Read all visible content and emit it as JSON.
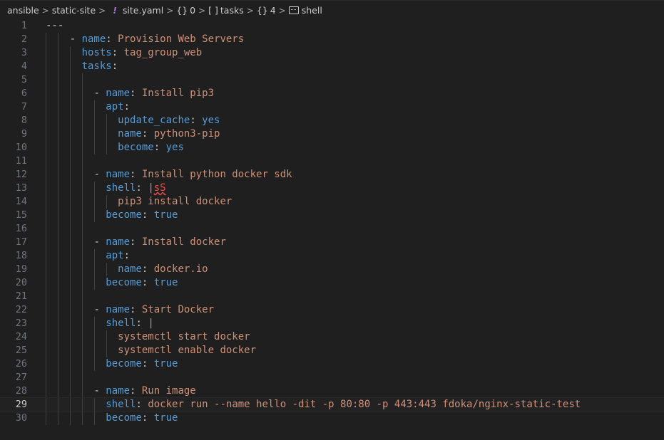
{
  "breadcrumb": {
    "items": [
      "ansible",
      "static-site",
      "site.yaml",
      "0",
      "tasks",
      "4",
      "shell"
    ],
    "symbols": [
      "{}",
      "[ ]",
      "{}"
    ],
    "icons": [
      "chevron-right-icon",
      "yaml-file-icon",
      "object-icon",
      "array-icon",
      "string-icon"
    ]
  },
  "editor": {
    "current_line": 29,
    "lines": [
      {
        "n": "1",
        "indent": 0,
        "tokens": [
          [
            "p",
            "---"
          ]
        ]
      },
      {
        "n": "2",
        "indent": 2,
        "tokens": [
          [
            "d",
            "- "
          ],
          [
            "k",
            "name"
          ],
          [
            "p",
            ": "
          ],
          [
            "s",
            "Provision Web Servers"
          ]
        ]
      },
      {
        "n": "3",
        "indent": 3,
        "tokens": [
          [
            "k",
            "hosts"
          ],
          [
            "p",
            ": "
          ],
          [
            "s",
            "tag_group_web"
          ]
        ]
      },
      {
        "n": "4",
        "indent": 3,
        "tokens": [
          [
            "k",
            "tasks"
          ],
          [
            "p",
            ":"
          ]
        ]
      },
      {
        "n": "5",
        "indent": 0,
        "tokens": []
      },
      {
        "n": "6",
        "indent": 4,
        "tokens": [
          [
            "d",
            "- "
          ],
          [
            "k",
            "name"
          ],
          [
            "p",
            ": "
          ],
          [
            "s",
            "Install pip3"
          ]
        ]
      },
      {
        "n": "7",
        "indent": 5,
        "tokens": [
          [
            "k",
            "apt"
          ],
          [
            "p",
            ":"
          ]
        ]
      },
      {
        "n": "8",
        "indent": 6,
        "tokens": [
          [
            "k",
            "update_cache"
          ],
          [
            "p",
            ": "
          ],
          [
            "k",
            "yes"
          ]
        ]
      },
      {
        "n": "9",
        "indent": 6,
        "tokens": [
          [
            "k",
            "name"
          ],
          [
            "p",
            ": "
          ],
          [
            "s",
            "python3-pip"
          ]
        ]
      },
      {
        "n": "10",
        "indent": 6,
        "tokens": [
          [
            "k",
            "become"
          ],
          [
            "p",
            ": "
          ],
          [
            "k",
            "yes"
          ]
        ]
      },
      {
        "n": "11",
        "indent": 0,
        "tokens": []
      },
      {
        "n": "12",
        "indent": 4,
        "tokens": [
          [
            "d",
            "- "
          ],
          [
            "k",
            "name"
          ],
          [
            "p",
            ": "
          ],
          [
            "s",
            "Install python docker sdk"
          ]
        ]
      },
      {
        "n": "13",
        "indent": 5,
        "tokens": [
          [
            "k",
            "shell"
          ],
          [
            "p",
            ": "
          ],
          [
            "pipe",
            "|"
          ],
          [
            "err",
            "sS"
          ]
        ]
      },
      {
        "n": "14",
        "indent": 6,
        "tokens": [
          [
            "s",
            "pip3 install docker"
          ]
        ]
      },
      {
        "n": "15",
        "indent": 5,
        "tokens": [
          [
            "k",
            "become"
          ],
          [
            "p",
            ": "
          ],
          [
            "k",
            "true"
          ]
        ]
      },
      {
        "n": "16",
        "indent": 0,
        "tokens": []
      },
      {
        "n": "17",
        "indent": 4,
        "tokens": [
          [
            "d",
            "- "
          ],
          [
            "k",
            "name"
          ],
          [
            "p",
            ": "
          ],
          [
            "s",
            "Install docker"
          ]
        ]
      },
      {
        "n": "18",
        "indent": 5,
        "tokens": [
          [
            "k",
            "apt"
          ],
          [
            "p",
            ":"
          ]
        ]
      },
      {
        "n": "19",
        "indent": 6,
        "tokens": [
          [
            "k",
            "name"
          ],
          [
            "p",
            ": "
          ],
          [
            "s",
            "docker.io"
          ]
        ]
      },
      {
        "n": "20",
        "indent": 5,
        "tokens": [
          [
            "k",
            "become"
          ],
          [
            "p",
            ": "
          ],
          [
            "k",
            "true"
          ]
        ]
      },
      {
        "n": "21",
        "indent": 0,
        "tokens": []
      },
      {
        "n": "22",
        "indent": 4,
        "tokens": [
          [
            "d",
            "- "
          ],
          [
            "k",
            "name"
          ],
          [
            "p",
            ": "
          ],
          [
            "s",
            "Start Docker"
          ]
        ]
      },
      {
        "n": "23",
        "indent": 5,
        "tokens": [
          [
            "k",
            "shell"
          ],
          [
            "p",
            ": "
          ],
          [
            "pipe",
            "|"
          ]
        ]
      },
      {
        "n": "24",
        "indent": 6,
        "tokens": [
          [
            "s",
            "systemctl start docker"
          ]
        ]
      },
      {
        "n": "25",
        "indent": 6,
        "tokens": [
          [
            "s",
            "systemctl enable docker"
          ]
        ]
      },
      {
        "n": "26",
        "indent": 5,
        "tokens": [
          [
            "k",
            "become"
          ],
          [
            "p",
            ": "
          ],
          [
            "k",
            "true"
          ]
        ]
      },
      {
        "n": "27",
        "indent": 0,
        "tokens": []
      },
      {
        "n": "28",
        "indent": 4,
        "tokens": [
          [
            "d",
            "- "
          ],
          [
            "k",
            "name"
          ],
          [
            "p",
            ": "
          ],
          [
            "s",
            "Run image"
          ]
        ]
      },
      {
        "n": "29",
        "indent": 5,
        "tokens": [
          [
            "k",
            "shell"
          ],
          [
            "p",
            ": "
          ],
          [
            "s",
            "docker run --name hello -dit -p 80:80 -p 443:443 fdoka/nginx-static-test"
          ]
        ]
      },
      {
        "n": "30",
        "indent": 5,
        "tokens": [
          [
            "k",
            "become"
          ],
          [
            "p",
            ": "
          ],
          [
            "k",
            "true"
          ]
        ]
      }
    ]
  }
}
